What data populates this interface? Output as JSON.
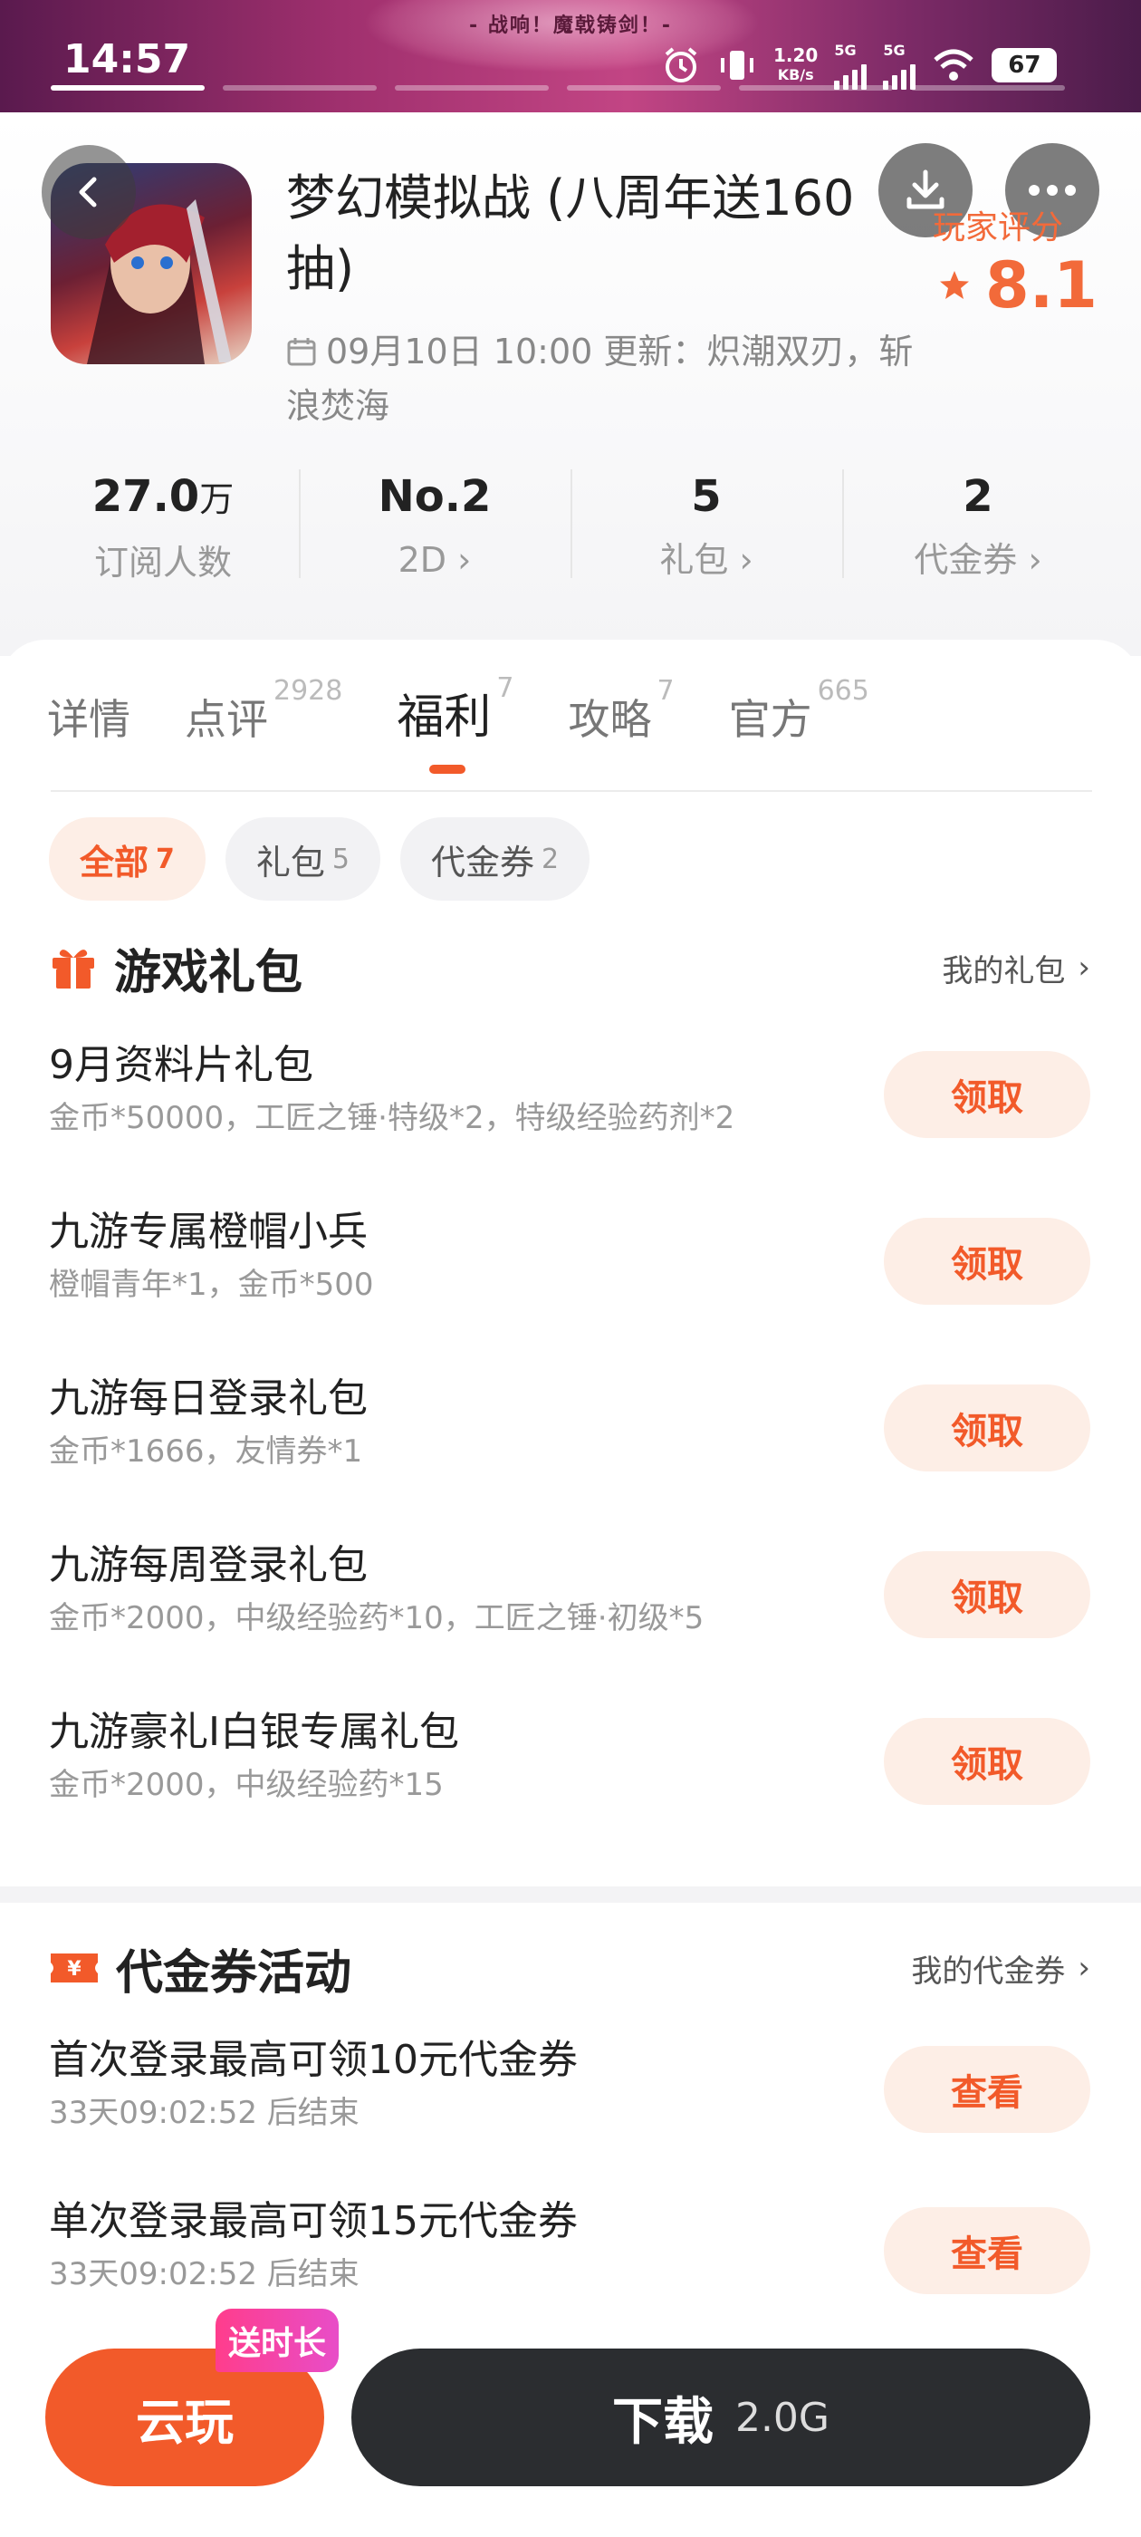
{
  "status_bar": {
    "time": "14:57",
    "net_speed_value": "1.20",
    "net_speed_unit": "KB/s",
    "network_1": "5G",
    "network_2": "5G",
    "battery": "67"
  },
  "banner": {
    "caption": "- 战响！魔戟铸剑！-"
  },
  "header": {
    "game_title": "梦幻模拟战 (八周年送160抽)",
    "update_text": "09月10日 10:00 更新：炽潮双刃，斩浪焚海",
    "rating_label": "玩家评分",
    "rating_value": "8.1"
  },
  "stats": [
    {
      "value": "27.0",
      "unit": "万",
      "label": "订阅人数",
      "has_arrow": false
    },
    {
      "value": "No.2",
      "unit": "",
      "label": "2D",
      "has_arrow": true
    },
    {
      "value": "5",
      "unit": "",
      "label": "礼包",
      "has_arrow": true
    },
    {
      "value": "2",
      "unit": "",
      "label": "代金券",
      "has_arrow": true
    }
  ],
  "tabs": [
    {
      "label": "详情",
      "count": ""
    },
    {
      "label": "点评",
      "count": "2928"
    },
    {
      "label": "福利",
      "count": "7"
    },
    {
      "label": "攻略",
      "count": "7"
    },
    {
      "label": "官方",
      "count": "665"
    }
  ],
  "active_tab": "福利",
  "filter_chips": [
    {
      "label": "全部",
      "count": "7"
    },
    {
      "label": "礼包",
      "count": "5"
    },
    {
      "label": "代金券",
      "count": "2"
    }
  ],
  "gift_section": {
    "title": "游戏礼包",
    "link": "我的礼包",
    "items": [
      {
        "title": "9月资料片礼包",
        "desc": "金币*50000，工匠之锤·特级*2，特级经验药剂*2",
        "action": "领取"
      },
      {
        "title": "九游专属橙帽小兵",
        "desc": "橙帽青年*1，金币*500",
        "action": "领取"
      },
      {
        "title": "九游每日登录礼包",
        "desc": "金币*1666，友情券*1",
        "action": "领取"
      },
      {
        "title": "九游每周登录礼包",
        "desc": "金币*2000，中级经验药*10，工匠之锤·初级*5",
        "action": "领取"
      },
      {
        "title": "九游豪礼I白银专属礼包",
        "desc": "金币*2000，中级经验药*15",
        "action": "领取"
      }
    ]
  },
  "voucher_section": {
    "title": "代金券活动",
    "link": "我的代金券",
    "items": [
      {
        "title": "首次登录最高可领10元代金券",
        "desc": "33天09:02:52 后结束",
        "action": "查看"
      },
      {
        "title": "单次登录最高可领15元代金券",
        "desc": "33天09:02:52 后结束",
        "action": "查看"
      }
    ]
  },
  "bottom_bar": {
    "cloud_play": "云玩",
    "cloud_badge": "送时长",
    "download": "下载",
    "download_size": "2.0G"
  },
  "colors": {
    "accent": "#f25a2a",
    "accent_soft": "#fdeee6",
    "dark_button": "#2b2d30",
    "badge": "#ff3d8c"
  }
}
